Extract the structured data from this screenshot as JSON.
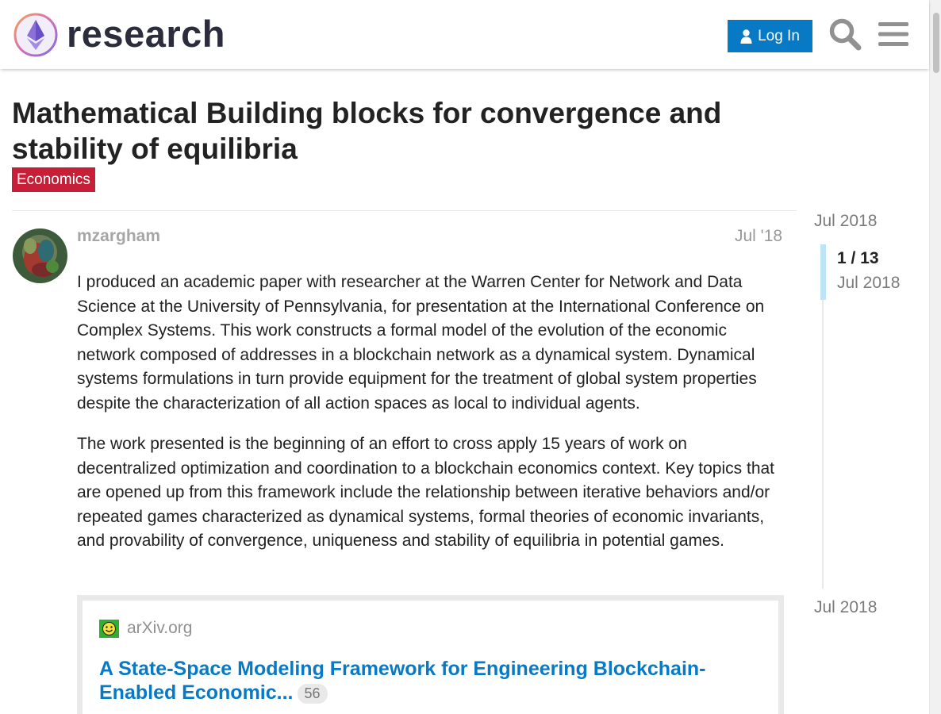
{
  "header": {
    "site_name": "research",
    "login_label": "Log In",
    "icons": [
      "logo-icon",
      "user-icon",
      "search-icon",
      "menu-icon"
    ]
  },
  "topic": {
    "title": "Mathematical Building blocks for convergence and stability of equilibria",
    "category": "Economics",
    "category_color": "#c71f37"
  },
  "post": {
    "username": "mzargham",
    "date": "Jul '18",
    "paragraphs": [
      "I produced an academic paper with researcher at the Warren Center for Network and Data Science at the University of Pennsylvania, for presentation at the International Conference on Complex Systems. This work constructs a formal model of the evolution of the economic network composed of addresses in a blockchain network as a dynamical system. Dynamical systems formulations in turn provide equipment for the treatment of global system properties despite the characterization of all action spaces as local to individual agents.",
      "The work presented is the beginning of an effort to cross apply 15 years of work on decentralized optimization and coordination to a blockchain economics context. Key topics that are opened up from this framework include the relationship between iterative behaviors and/or repeated games characterized as dynamical systems, formal theories of economic invariants, and provability of convergence, uniqueness and stability of equilibria in potential games."
    ],
    "onebox": {
      "source": "arXiv.org",
      "title": "A State-Space Modeling Framework for Engineering Blockchain-Enabled Economic...",
      "click_count": "56"
    }
  },
  "timeline": {
    "start_date": "Jul 2018",
    "position": "1 / 13",
    "position_date": "Jul 2018",
    "end_date": "Jul 2018"
  },
  "colors": {
    "accent": "#0879c4",
    "header_text": "#2b2d3d",
    "muted": "#919191"
  }
}
